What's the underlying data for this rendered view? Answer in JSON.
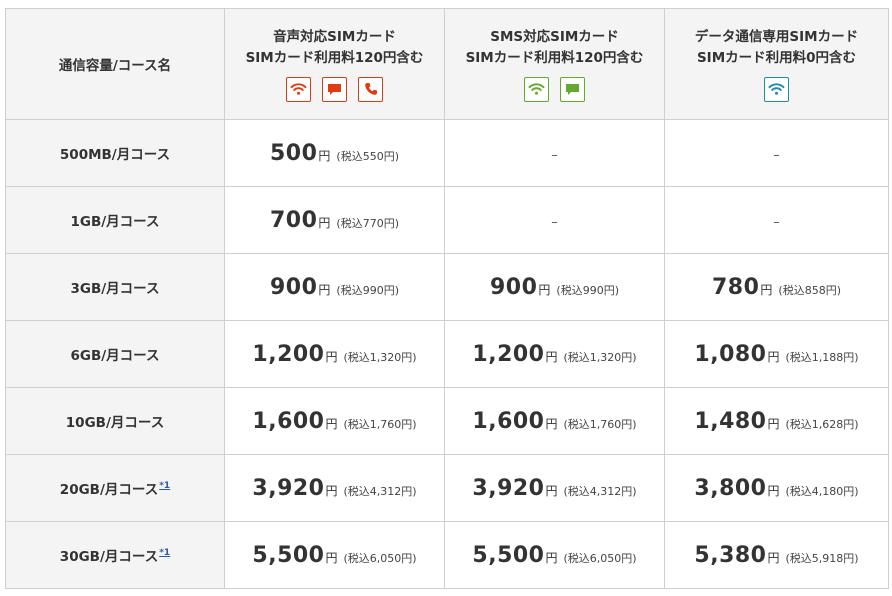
{
  "header": {
    "corner": "通信容量/コース名",
    "plans": [
      {
        "line1": "音声対応SIMカード",
        "line2": "SIMカード利用料120円含む",
        "icons": [
          "wifi-icon",
          "message-icon",
          "phone-icon"
        ],
        "icon_color": "#e03a12"
      },
      {
        "line1": "SMS対応SIMカード",
        "line2": "SIMカード利用料120円含む",
        "icons": [
          "wifi-icon",
          "message-icon"
        ],
        "icon_color": "#63a82f"
      },
      {
        "line1": "データ通信専用SIMカード",
        "line2": "SIMカード利用料0円含む",
        "icons": [
          "wifi-icon"
        ],
        "icon_color": "#1f8bab"
      }
    ]
  },
  "yen_label": "円",
  "dash": "–",
  "rows": [
    {
      "name": "500MB/月コース",
      "note": "",
      "cells": [
        {
          "price": "500",
          "tax": "(税込550円)"
        },
        {
          "dash": true
        },
        {
          "dash": true
        }
      ]
    },
    {
      "name": "1GB/月コース",
      "note": "",
      "cells": [
        {
          "price": "700",
          "tax": "(税込770円)"
        },
        {
          "dash": true
        },
        {
          "dash": true
        }
      ]
    },
    {
      "name": "3GB/月コース",
      "note": "",
      "cells": [
        {
          "price": "900",
          "tax": "(税込990円)"
        },
        {
          "price": "900",
          "tax": "(税込990円)"
        },
        {
          "price": "780",
          "tax": "(税込858円)"
        }
      ]
    },
    {
      "name": "6GB/月コース",
      "note": "",
      "cells": [
        {
          "price": "1,200",
          "tax": "(税込1,320円)"
        },
        {
          "price": "1,200",
          "tax": "(税込1,320円)"
        },
        {
          "price": "1,080",
          "tax": "(税込1,188円)"
        }
      ]
    },
    {
      "name": "10GB/月コース",
      "note": "",
      "cells": [
        {
          "price": "1,600",
          "tax": "(税込1,760円)"
        },
        {
          "price": "1,600",
          "tax": "(税込1,760円)"
        },
        {
          "price": "1,480",
          "tax": "(税込1,628円)"
        }
      ]
    },
    {
      "name": "20GB/月コース",
      "note": "*1",
      "cells": [
        {
          "price": "3,920",
          "tax": "(税込4,312円)"
        },
        {
          "price": "3,920",
          "tax": "(税込4,312円)"
        },
        {
          "price": "3,800",
          "tax": "(税込4,180円)"
        }
      ]
    },
    {
      "name": "30GB/月コース",
      "note": "*1",
      "cells": [
        {
          "price": "5,500",
          "tax": "(税込6,050円)"
        },
        {
          "price": "5,500",
          "tax": "(税込6,050円)"
        },
        {
          "price": "5,380",
          "tax": "(税込5,918円)"
        }
      ]
    }
  ]
}
